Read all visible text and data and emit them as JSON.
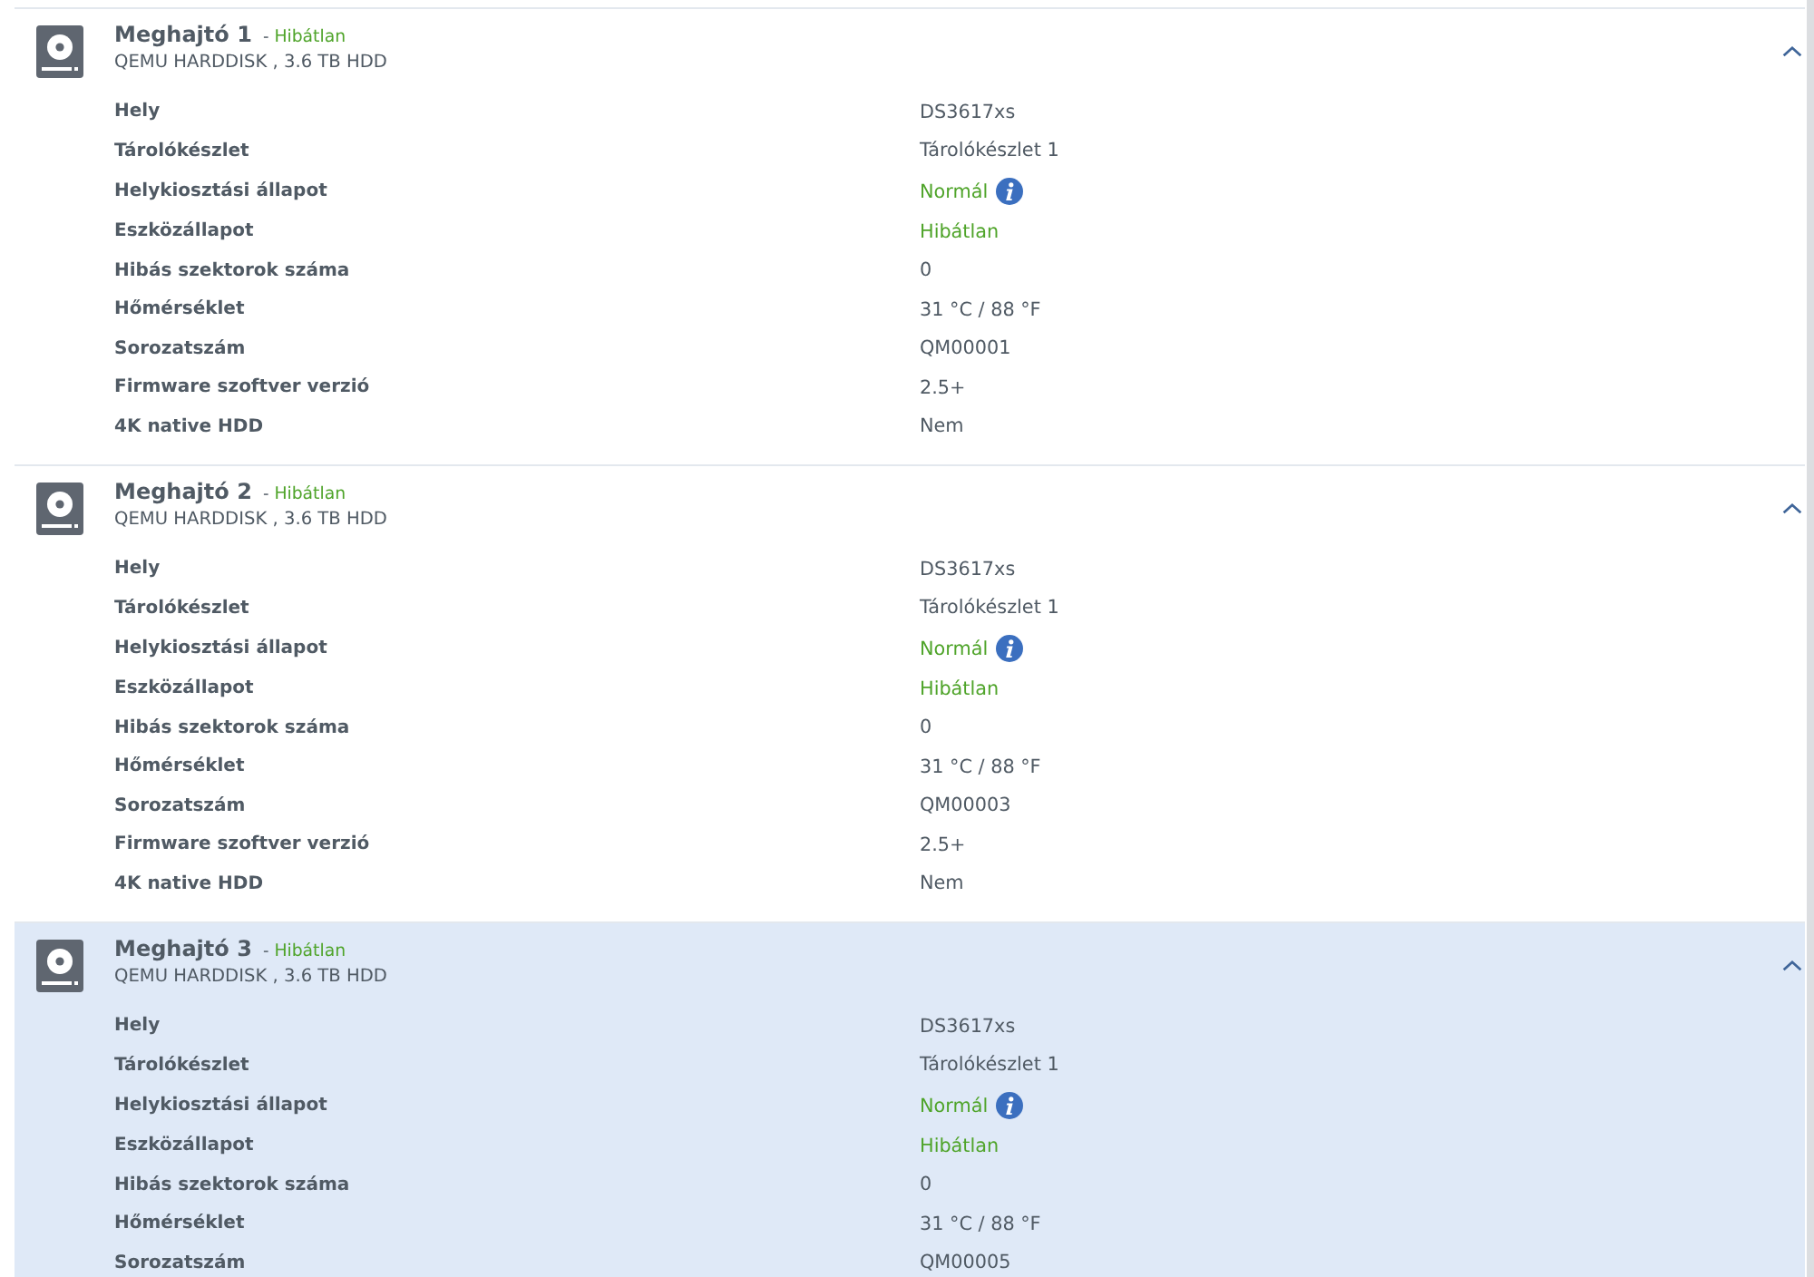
{
  "drives": [
    {
      "title": "Meghajtó 1",
      "separator": "-",
      "status": "Hibátlan",
      "model": "QEMU HARDDISK , 3.6 TB HDD",
      "expanded": true,
      "selected": false,
      "details": [
        {
          "label": "Hely",
          "value": "DS3617xs",
          "kind": "plain"
        },
        {
          "label": "Tárolókészlet",
          "value": "Tárolókészlet 1",
          "kind": "plain"
        },
        {
          "label": "Helykiosztási állapot",
          "value": "Normál",
          "kind": "status_info"
        },
        {
          "label": "Eszközállapot",
          "value": "Hibátlan",
          "kind": "status"
        },
        {
          "label": "Hibás szektorok száma",
          "value": "0",
          "kind": "plain"
        },
        {
          "label": "Hőmérséklet",
          "value": "31 °C / 88 °F",
          "kind": "plain"
        },
        {
          "label": "Sorozatszám",
          "value": "QM00001",
          "kind": "plain"
        },
        {
          "label": "Firmware szoftver verzió",
          "value": "2.5+",
          "kind": "plain"
        },
        {
          "label": "4K native HDD",
          "value": "Nem",
          "kind": "plain"
        }
      ]
    },
    {
      "title": "Meghajtó 2",
      "separator": "-",
      "status": "Hibátlan",
      "model": "QEMU HARDDISK , 3.6 TB HDD",
      "expanded": true,
      "selected": false,
      "details": [
        {
          "label": "Hely",
          "value": "DS3617xs",
          "kind": "plain"
        },
        {
          "label": "Tárolókészlet",
          "value": "Tárolókészlet 1",
          "kind": "plain"
        },
        {
          "label": "Helykiosztási állapot",
          "value": "Normál",
          "kind": "status_info"
        },
        {
          "label": "Eszközállapot",
          "value": "Hibátlan",
          "kind": "status"
        },
        {
          "label": "Hibás szektorok száma",
          "value": "0",
          "kind": "plain"
        },
        {
          "label": "Hőmérséklet",
          "value": "31 °C / 88 °F",
          "kind": "plain"
        },
        {
          "label": "Sorozatszám",
          "value": "QM00003",
          "kind": "plain"
        },
        {
          "label": "Firmware szoftver verzió",
          "value": "2.5+",
          "kind": "plain"
        },
        {
          "label": "4K native HDD",
          "value": "Nem",
          "kind": "plain"
        }
      ]
    },
    {
      "title": "Meghajtó 3",
      "separator": "-",
      "status": "Hibátlan",
      "model": "QEMU HARDDISK , 3.6 TB HDD",
      "expanded": true,
      "selected": true,
      "details": [
        {
          "label": "Hely",
          "value": "DS3617xs",
          "kind": "plain"
        },
        {
          "label": "Tárolókészlet",
          "value": "Tárolókészlet 1",
          "kind": "plain"
        },
        {
          "label": "Helykiosztási állapot",
          "value": "Normál",
          "kind": "status_info"
        },
        {
          "label": "Eszközállapot",
          "value": "Hibátlan",
          "kind": "status"
        },
        {
          "label": "Hibás szektorok száma",
          "value": "0",
          "kind": "plain"
        },
        {
          "label": "Hőmérséklet",
          "value": "31 °C / 88 °F",
          "kind": "plain"
        },
        {
          "label": "Sorozatszám",
          "value": "QM00005",
          "kind": "plain"
        }
      ]
    }
  ]
}
